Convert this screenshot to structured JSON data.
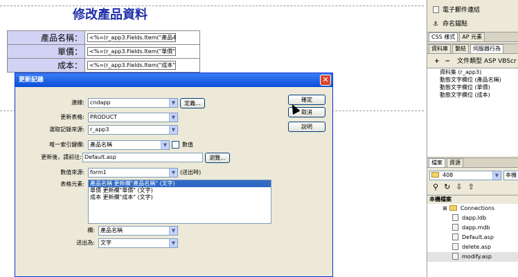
{
  "document": {
    "title": "修改產品資料",
    "rows": [
      {
        "label": "產品名稱：",
        "value": "<%=(r_app3.Fields.Item(\"產品4"
      },
      {
        "label": "單價：",
        "value": "<%=(r_app3.Fields.Item(\"單價\""
      },
      {
        "label": "成本：",
        "value": "<%=(r_app3.Fields.Item(\"成本\""
      }
    ]
  },
  "right_panel": {
    "items": [
      {
        "label": "電子郵件連結"
      },
      {
        "label": "命名錨點"
      }
    ],
    "tabs1": [
      "CSS 樣式",
      "AP 元素"
    ],
    "tabs2": [
      "資料庫",
      "繫結",
      "伺服器行為"
    ],
    "toolbar_text": "文件類型 ASP VBScr",
    "bindings": [
      "資料集 (r_app3)",
      "動態文字欄位 (產品名稱)",
      "動態文字欄位 (單價)",
      "動態文字欄位 (成本)"
    ],
    "files_tabs": [
      "檔案",
      "資源"
    ],
    "site_select": "408",
    "local_select": "本機",
    "local_files_header": "本機檔案",
    "files": [
      "Connections",
      "dapp.ldb",
      "dapp.mdb",
      "Default.asp",
      "delete.asp",
      "modify.asp"
    ]
  },
  "dialog": {
    "title": "更新記錄",
    "close_glyph": "✕",
    "connection_label": "連線:",
    "connection_value": "cndapp",
    "define_button": "定義...",
    "table_label": "更新表格:",
    "table_value": "PRODUCT",
    "recordset_label": "選取記錄來源:",
    "recordset_value": "r_app3",
    "unique_key_label": "唯一索引鍵欄:",
    "unique_key_value": "產品名稱",
    "numeric_label": "數值",
    "after_update_label": "更新後，請前往:",
    "after_update_value": "Default.asp",
    "browse_button": "瀏覽...",
    "get_values_label": "數值來源:",
    "get_values_value": "form1",
    "when_submitted": "(送出時)",
    "form_elements_label": "表格元素:",
    "form_elements": [
      "產品名稱 更新欄\"產品名稱\" (文字)",
      "單價 更新欄\"單價\" (文字)",
      "成本 更新欄\"成本\" (文字)"
    ],
    "column_label": "欄:",
    "column_value": "產品名稱",
    "submit_as_label": "送出為:",
    "submit_as_value": "文字",
    "ok_button": "確定",
    "cancel_button": "取消",
    "help_button": "說明"
  }
}
